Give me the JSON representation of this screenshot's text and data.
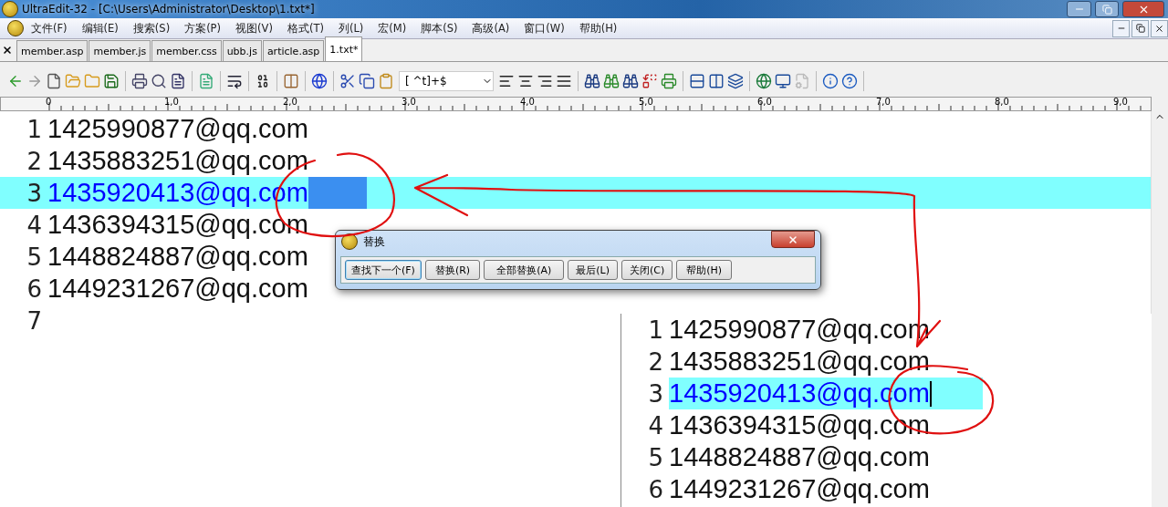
{
  "window": {
    "title": "UltraEdit-32 - [C:\\Users\\Administrator\\Desktop\\1.txt*]"
  },
  "menu": [
    "文件(F)",
    "编辑(E)",
    "搜索(S)",
    "方案(P)",
    "视图(V)",
    "格式(T)",
    "列(L)",
    "宏(M)",
    "脚本(S)",
    "高级(A)",
    "窗口(W)",
    "帮助(H)"
  ],
  "tabs": [
    {
      "label": "member.asp",
      "selected": false
    },
    {
      "label": "member.js",
      "selected": false
    },
    {
      "label": "member.css",
      "selected": false
    },
    {
      "label": "ubb.js",
      "selected": false
    },
    {
      "label": "article.asp",
      "selected": false
    },
    {
      "label": "1.txt*",
      "selected": true
    }
  ],
  "toolbar": {
    "search_combo": "[ ^t]+$"
  },
  "ruler": [
    "0",
    "1,0",
    "2,0",
    "3,0",
    "4,0",
    "5,0",
    "6,0",
    "7,0",
    "8,0",
    "9,0"
  ],
  "editor": {
    "lines": [
      {
        "number": "1",
        "text": "1425990877@qq.com",
        "selected": false
      },
      {
        "number": "2",
        "text": "1435883251@qq.com",
        "selected": false
      },
      {
        "number": "3",
        "text": "1435920413@qq.com",
        "selected": true
      },
      {
        "number": "4",
        "text": "1436394315@qq.com",
        "selected": false
      },
      {
        "number": "5",
        "text": "1448824887@qq.com",
        "selected": false
      },
      {
        "number": "6",
        "text": "1449231267@qq.com",
        "selected": false
      },
      {
        "number": "7",
        "selected": false
      }
    ]
  },
  "dialog": {
    "title": "替换",
    "buttons": [
      {
        "label": "查找下一个(F)",
        "focused": true
      },
      {
        "label": "替换(R)",
        "focused": false
      },
      {
        "label": "全部替换(A)",
        "focused": false
      },
      {
        "label": "最后(L)",
        "focused": false
      },
      {
        "label": "关闭(C)",
        "focused": false
      },
      {
        "label": "帮助(H)",
        "focused": false
      }
    ]
  },
  "inset": {
    "lines": [
      {
        "number": "1",
        "text": "1425990877@qq.com",
        "selected": false
      },
      {
        "number": "2",
        "text": "1435883251@qq.com",
        "selected": false
      },
      {
        "number": "3",
        "text": "1435920413@qq.com",
        "selected": true
      },
      {
        "number": "4",
        "text": "1436394315@qq.com",
        "selected": false
      },
      {
        "number": "5",
        "text": "1448824887@qq.com",
        "selected": false
      },
      {
        "number": "6",
        "text": "1449231267@qq.com",
        "selected": false
      }
    ]
  }
}
